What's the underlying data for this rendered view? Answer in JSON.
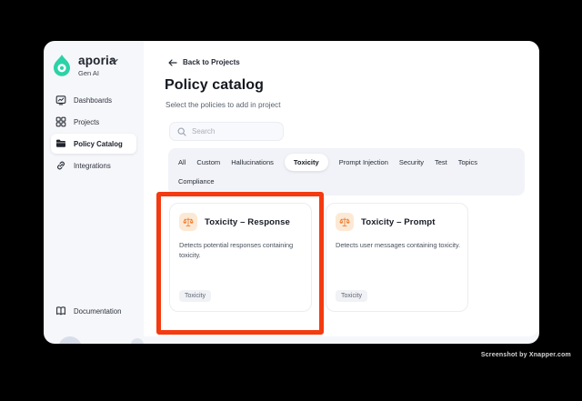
{
  "window": {
    "brand": {
      "name": "aporia",
      "workspace": "Gen AI"
    },
    "sidebar": {
      "items": [
        {
          "label": "Dashboards"
        },
        {
          "label": "Projects"
        },
        {
          "label": "Policy Catalog",
          "active": true
        },
        {
          "label": "Integrations"
        }
      ],
      "footer_item": {
        "label": "Documentation"
      }
    },
    "main": {
      "back_link": "Back to Projects",
      "title": "Policy catalog",
      "subtitle": "Select the policies to add in project",
      "search": {
        "placeholder": "Search"
      },
      "tabs": [
        "All",
        "Custom",
        "Hallucinations",
        "Toxicity",
        "Prompt Injection",
        "Security",
        "Test",
        "Topics",
        "Compliance"
      ],
      "active_tab": "Toxicity",
      "cards": [
        {
          "title": "Toxicity – Response",
          "description": "Detects potential responses containing toxicity.",
          "tag": "Toxicity",
          "highlighted": true
        },
        {
          "title": "Toxicity – Prompt",
          "description": "Detects user messages containing toxicity.",
          "tag": "Toxicity",
          "highlighted": false
        }
      ]
    }
  },
  "watermark": "Screenshot by Xnapper.com",
  "colors": {
    "brand_teal": "#2BD2A7",
    "highlight_red": "#F43A10",
    "card_icon_orange": "#ED7B2F",
    "card_icon_bg": "#FCE9D5",
    "window_bg": "#F6F7FA",
    "tabs_bg": "#F2F3F8"
  }
}
